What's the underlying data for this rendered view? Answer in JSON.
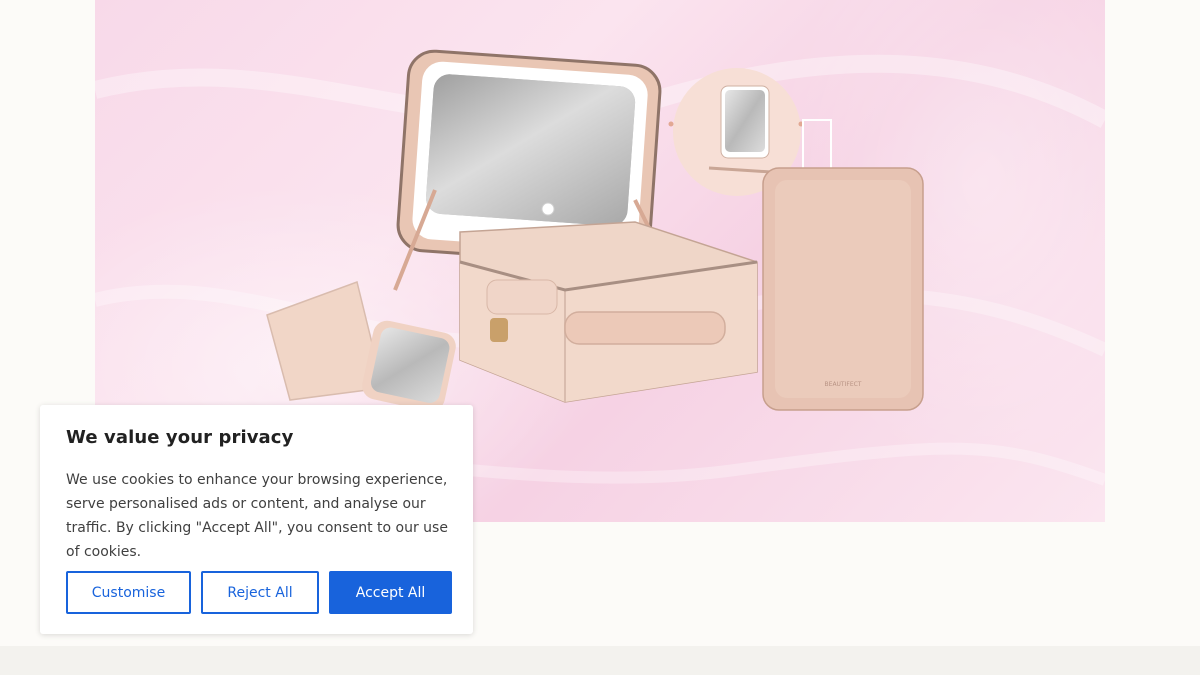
{
  "hero": {
    "image": "beauty-travel-case-product-photo",
    "accent_color": "#f8d9e9"
  },
  "cookie_banner": {
    "title": "We value your privacy",
    "text": "We use cookies to enhance your browsing experience, serve personalised ads or content, and analyse our traffic. By clicking \"Accept All\", you consent to our use of cookies.",
    "buttons": {
      "customise": "Customise",
      "reject": "Reject All",
      "accept": "Accept All"
    },
    "colors": {
      "primary": "#1863dc"
    }
  }
}
